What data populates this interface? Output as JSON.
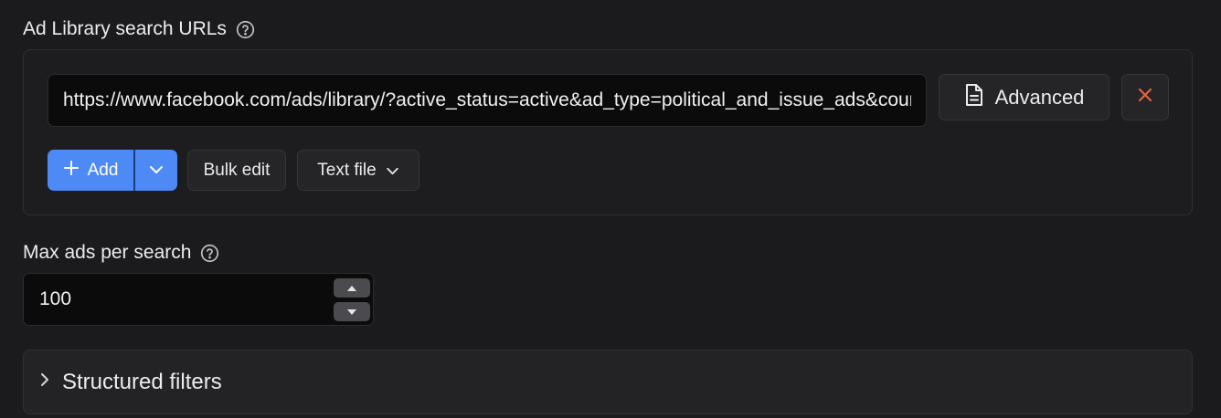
{
  "search_urls": {
    "label": "Ad Library search URLs",
    "url_value": "https://www.facebook.com/ads/library/?active_status=active&ad_type=political_and_issue_ads&country=US",
    "advanced_label": "Advanced",
    "add_label": "Add",
    "bulk_edit_label": "Bulk edit",
    "text_file_label": "Text file"
  },
  "max_ads": {
    "label": "Max ads per search",
    "value": "100"
  },
  "structured_filters": {
    "title": "Structured filters"
  },
  "colors": {
    "accent": "#4d8af5",
    "danger": "#e8613f",
    "background": "#1b1b1d"
  },
  "icons": {
    "help": "question-circle-icon",
    "advanced": "document-icon",
    "remove": "close-icon",
    "add": "plus-icon",
    "dropdown": "chevron-down-icon",
    "expand": "chevron-right-icon"
  }
}
